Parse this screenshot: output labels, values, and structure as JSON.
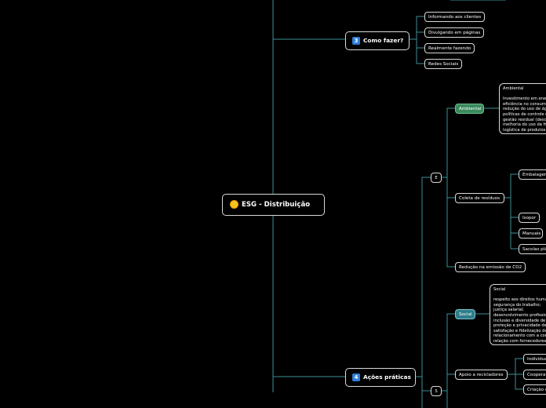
{
  "root": {
    "title": "ESG - Distribuição",
    "icon": "sun-icon"
  },
  "como_fazer": {
    "number": "3",
    "title": "Como fazer?",
    "items": [
      "Informando aos clientes",
      "Divulgando em páginas",
      "Realmente fazendo",
      "Redes Sociais"
    ]
  },
  "acoes_praticas": {
    "number": "4",
    "title": "Ações práticas",
    "e": {
      "letter": "E",
      "ambiental": {
        "label": "Ambiental",
        "note": "Ambiental\n\nInvestimento em energia;\neficiência no consumo;\nredução do uso de água;\npolíticas de controle de\ngestão residual (descarte);\nmelhoria do uso da frota;\nlogística de produtos"
      },
      "coleta": {
        "label": "Coleta de resíduos",
        "items": [
          "Embalagens",
          "Isopor",
          "Manuais",
          "Sacolas plásticas"
        ]
      },
      "reducao": "Redução na emissão de CO2"
    },
    "s": {
      "letter": "S",
      "social": {
        "label": "Social",
        "note": "Social\n\nrespeito aos direitos humanos;\nsegurança do trabalho;\njustiça salarial;\ndesenvolvimento profissional;\ninclusão e diversidade de gênero;\nproteção e privacidade de dados;\nsatisfação e fidelização de clientes;\nrelacionamento com a comunidade;\nrelação com fornecedores"
      },
      "apoio": {
        "label": "Apoio a recicladores",
        "items": [
          "Individuais",
          "Cooperativas",
          "Criação de"
        ]
      }
    }
  },
  "colors": {
    "line": "#3d8f96",
    "border": "#d9d9d9",
    "green": "#3a8a5c",
    "teal": "#2f7d8a",
    "badge": "#2f7ed8"
  }
}
